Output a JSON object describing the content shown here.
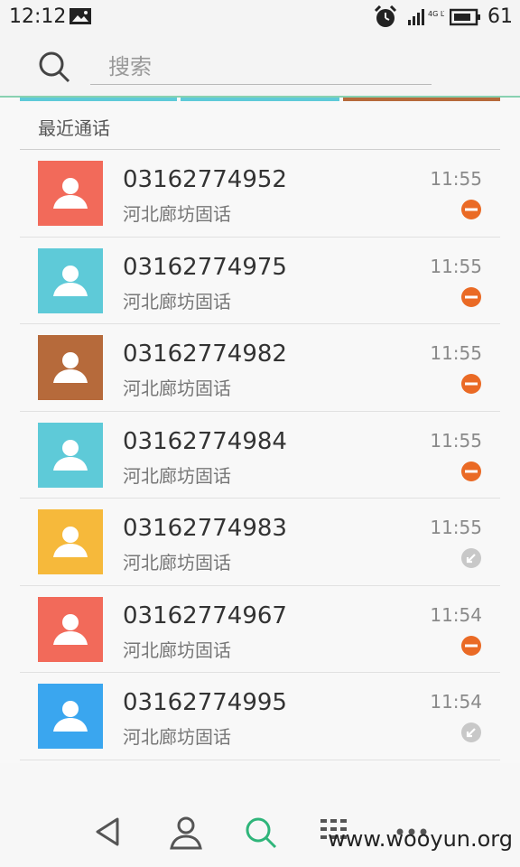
{
  "status_bar": {
    "time": "12:12",
    "battery": "61",
    "network_label": "4G LTE"
  },
  "search": {
    "placeholder": "搜索"
  },
  "section": {
    "title": "最近通话"
  },
  "calls": [
    {
      "number": "03162774952",
      "location": "河北廊坊固话",
      "time": "11:55",
      "avatar_color": "#f26a5a",
      "status": "missed-icon"
    },
    {
      "number": "03162774975",
      "location": "河北廊坊固话",
      "time": "11:55",
      "avatar_color": "#5ecad8",
      "status": "missed-icon"
    },
    {
      "number": "03162774982",
      "location": "河北廊坊固话",
      "time": "11:55",
      "avatar_color": "#b66a3b",
      "status": "missed-icon"
    },
    {
      "number": "03162774984",
      "location": "河北廊坊固话",
      "time": "11:55",
      "avatar_color": "#5ecad8",
      "status": "missed-icon"
    },
    {
      "number": "03162774983",
      "location": "河北廊坊固话",
      "time": "11:55",
      "avatar_color": "#f6b93b",
      "status": "incoming-icon"
    },
    {
      "number": "03162774967",
      "location": "河北廊坊固话",
      "time": "11:54",
      "avatar_color": "#f26a5a",
      "status": "missed-icon"
    },
    {
      "number": "03162774995",
      "location": "河北廊坊固话",
      "time": "11:54",
      "avatar_color": "#3aa6ef",
      "status": "incoming-icon"
    }
  ],
  "colors": {
    "missed": "#ea6a25",
    "incoming": "#c8c8c8",
    "accent": "#2fb57a"
  },
  "bottom_nav": {
    "items": [
      "back-icon",
      "contacts-icon",
      "search-icon",
      "dialpad-icon",
      "more-icon"
    ]
  },
  "watermark": "www.wooyun.org"
}
